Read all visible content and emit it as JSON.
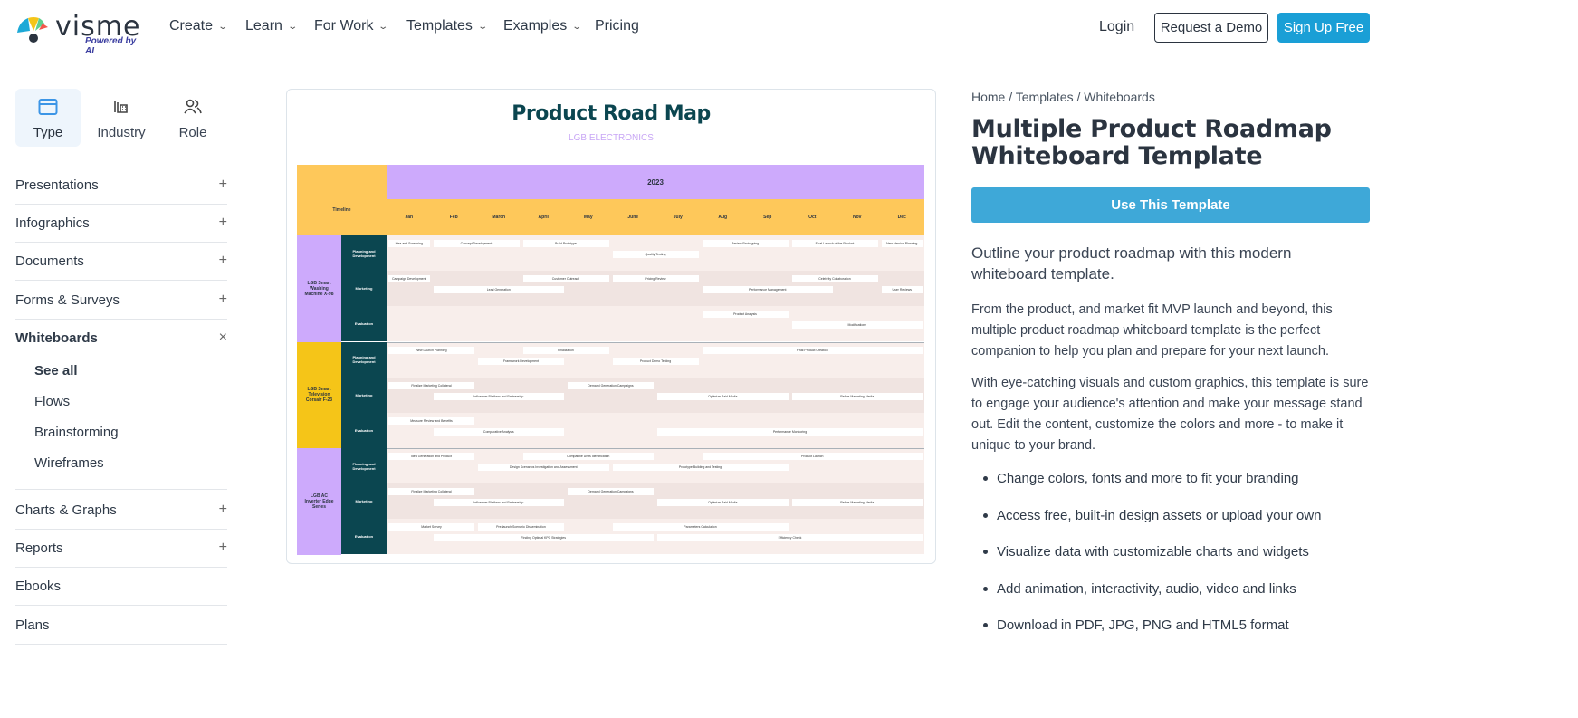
{
  "brand": {
    "name": "visme",
    "tagline": "Powered by AI"
  },
  "nav": {
    "items": [
      {
        "label": "Create",
        "dropdown": true
      },
      {
        "label": "Learn",
        "dropdown": true
      },
      {
        "label": "For Work",
        "dropdown": true
      },
      {
        "label": "Templates",
        "dropdown": true
      },
      {
        "label": "Examples",
        "dropdown": true
      },
      {
        "label": "Pricing",
        "dropdown": false
      }
    ],
    "login": "Login",
    "demo": "Request a Demo",
    "signup": "Sign Up Free"
  },
  "sidebar": {
    "tabs": [
      {
        "label": "Type",
        "icon": "window-icon",
        "active": true
      },
      {
        "label": "Industry",
        "icon": "building-icon"
      },
      {
        "label": "Role",
        "icon": "users-icon"
      }
    ],
    "categories": [
      {
        "label": "Presentations",
        "toggle": "+"
      },
      {
        "label": "Infographics",
        "toggle": "+"
      },
      {
        "label": "Documents",
        "toggle": "+"
      },
      {
        "label": "Forms & Surveys",
        "toggle": "+"
      },
      {
        "label": "Whiteboards",
        "toggle": "×",
        "expanded": true
      },
      {
        "label": "Charts & Graphs",
        "toggle": "+"
      },
      {
        "label": "Reports",
        "toggle": "+"
      },
      {
        "label": "Ebooks",
        "toggle": ""
      },
      {
        "label": "Plans",
        "toggle": ""
      }
    ],
    "sub_items": [
      "See all",
      "Flows",
      "Brainstorming",
      "Wireframes"
    ]
  },
  "preview": {
    "title": "Product Road Map",
    "subtitle": "LGB ELECTRONICS",
    "timeline_label": "Timeline",
    "year": "2023",
    "months": [
      "Jan",
      "Feb",
      "March",
      "April",
      "May",
      "June",
      "July",
      "Aug",
      "Sep",
      "Oct",
      "Nov",
      "Dec"
    ],
    "phases": [
      "Planning and Development",
      "Marketing",
      "Evaluation"
    ],
    "products": [
      {
        "name": "LGB Smart Washing Machine X-98",
        "color": "#cdaafc"
      },
      {
        "name": "LGB Smart Television Corsair F-23",
        "color": "#f5c518"
      },
      {
        "name": "LGB AC Inverter Edge Series",
        "color": "#cdaafc"
      }
    ],
    "colors": {
      "header_year": "#cdaafc",
      "header_months": "#fec85a",
      "phase": "#0b4650",
      "row_light": "#f8eeeb",
      "row_dark": "#f0e4e1"
    },
    "tasks": [
      {
        "p": 0,
        "r": 0,
        "s": 1,
        "e": 1,
        "l": 0,
        "t": "Idea and Screening"
      },
      {
        "p": 0,
        "r": 0,
        "s": 2,
        "e": 3,
        "l": 0,
        "t": "Concept Development"
      },
      {
        "p": 0,
        "r": 0,
        "s": 4,
        "e": 5,
        "l": 0,
        "t": "Build Prototype"
      },
      {
        "p": 0,
        "r": 0,
        "s": 6,
        "e": 7,
        "l": 1,
        "t": "Quality Testing"
      },
      {
        "p": 0,
        "r": 0,
        "s": 8,
        "e": 9,
        "l": 0,
        "t": "Review Prototyping"
      },
      {
        "p": 0,
        "r": 0,
        "s": 10,
        "e": 11,
        "l": 0,
        "t": "Final Launch of the Product"
      },
      {
        "p": 0,
        "r": 0,
        "s": 12,
        "e": 12,
        "l": 0,
        "t": "New Version Planning"
      },
      {
        "p": 0,
        "r": 1,
        "s": 1,
        "e": 1,
        "l": 0,
        "t": "Campaign Development"
      },
      {
        "p": 0,
        "r": 1,
        "s": 2,
        "e": 4,
        "l": 1,
        "t": "Lead Generation"
      },
      {
        "p": 0,
        "r": 1,
        "s": 4,
        "e": 5,
        "l": 0,
        "t": "Customer Outreach"
      },
      {
        "p": 0,
        "r": 1,
        "s": 6,
        "e": 7,
        "l": 0,
        "t": "Pricing Review"
      },
      {
        "p": 0,
        "r": 1,
        "s": 8,
        "e": 10,
        "l": 1,
        "t": "Performance Management"
      },
      {
        "p": 0,
        "r": 1,
        "s": 10,
        "e": 11,
        "l": 0,
        "t": "Celebrity Collaboration"
      },
      {
        "p": 0,
        "r": 1,
        "s": 12,
        "e": 12,
        "l": 1,
        "t": "User Reviews"
      },
      {
        "p": 0,
        "r": 2,
        "s": 8,
        "e": 9,
        "l": 0,
        "t": "Product Analysis"
      },
      {
        "p": 0,
        "r": 2,
        "s": 10,
        "e": 12,
        "l": 1,
        "t": "Modifications"
      },
      {
        "p": 1,
        "r": 0,
        "s": 1,
        "e": 2,
        "l": 0,
        "t": "New Launch Planning"
      },
      {
        "p": 1,
        "r": 0,
        "s": 3,
        "e": 4,
        "l": 1,
        "t": "Framework Development"
      },
      {
        "p": 1,
        "r": 0,
        "s": 4,
        "e": 5,
        "l": 0,
        "t": "Finalization"
      },
      {
        "p": 1,
        "r": 0,
        "s": 6,
        "e": 7,
        "l": 1,
        "t": "Product Demo Testing"
      },
      {
        "p": 1,
        "r": 0,
        "s": 8,
        "e": 12,
        "l": 0,
        "t": "Final Product Creation"
      },
      {
        "p": 1,
        "r": 1,
        "s": 1,
        "e": 2,
        "l": 0,
        "t": "Finalize Marketing Collateral"
      },
      {
        "p": 1,
        "r": 1,
        "s": 2,
        "e": 4,
        "l": 1,
        "t": "Influencer Platform and Partnership"
      },
      {
        "p": 1,
        "r": 1,
        "s": 5,
        "e": 6,
        "l": 0,
        "t": "Demand Generation Campaigns"
      },
      {
        "p": 1,
        "r": 1,
        "s": 7,
        "e": 9,
        "l": 1,
        "t": "Optimize Paid Media"
      },
      {
        "p": 1,
        "r": 1,
        "s": 10,
        "e": 12,
        "l": 1,
        "t": "Refine Marketing Media"
      },
      {
        "p": 1,
        "r": 2,
        "s": 1,
        "e": 2,
        "l": 0,
        "t": "Measure Review and Benefits"
      },
      {
        "p": 1,
        "r": 2,
        "s": 2,
        "e": 4,
        "l": 1,
        "t": "Comparative Analysis"
      },
      {
        "p": 1,
        "r": 2,
        "s": 7,
        "e": 12,
        "l": 1,
        "t": "Performance Monitoring"
      },
      {
        "p": 2,
        "r": 0,
        "s": 1,
        "e": 2,
        "l": 0,
        "t": "Idea Generation and Product"
      },
      {
        "p": 2,
        "r": 0,
        "s": 4,
        "e": 6,
        "l": 0,
        "t": "Compatible Units Identification"
      },
      {
        "p": 2,
        "r": 0,
        "s": 3,
        "e": 5,
        "l": 1,
        "t": "Design Scenarios Investigation and Assessment"
      },
      {
        "p": 2,
        "r": 0,
        "s": 6,
        "e": 9,
        "l": 1,
        "t": "Prototype Building and Testing"
      },
      {
        "p": 2,
        "r": 0,
        "s": 8,
        "e": 12,
        "l": 0,
        "t": "Product Launch"
      },
      {
        "p": 2,
        "r": 1,
        "s": 1,
        "e": 2,
        "l": 0,
        "t": "Finalize Marketing Collateral"
      },
      {
        "p": 2,
        "r": 1,
        "s": 2,
        "e": 4,
        "l": 1,
        "t": "Influencer Platform and Partnership"
      },
      {
        "p": 2,
        "r": 1,
        "s": 5,
        "e": 6,
        "l": 0,
        "t": "Demand Generation Campaigns"
      },
      {
        "p": 2,
        "r": 1,
        "s": 7,
        "e": 9,
        "l": 1,
        "t": "Optimize Paid Media"
      },
      {
        "p": 2,
        "r": 1,
        "s": 10,
        "e": 12,
        "l": 1,
        "t": "Refine Marketing Media"
      },
      {
        "p": 2,
        "r": 2,
        "s": 1,
        "e": 2,
        "l": 0,
        "t": "Market Survey"
      },
      {
        "p": 2,
        "r": 2,
        "s": 3,
        "e": 4,
        "l": 0,
        "t": "Pre-launch Scenario Dissemination"
      },
      {
        "p": 2,
        "r": 2,
        "s": 2,
        "e": 6,
        "l": 1,
        "t": "Finding Optimal KPC Strategies"
      },
      {
        "p": 2,
        "r": 2,
        "s": 6,
        "e": 9,
        "l": 0,
        "t": "Parameters Calculation"
      },
      {
        "p": 2,
        "r": 2,
        "s": 7,
        "e": 12,
        "l": 1,
        "t": "Efficiency Check"
      }
    ]
  },
  "detail": {
    "breadcrumb": "Home / Templates / Whiteboards",
    "title": "Multiple Product Roadmap Whiteboard Template",
    "cta": "Use This Template",
    "lead": "Outline your product roadmap with this modern whiteboard template.",
    "p1": "From the product, and market fit MVP launch and beyond, this multiple product roadmap whiteboard template is the perfect companion to help you plan and prepare for your next launch.",
    "p2": "With eye-catching visuals and custom graphics, this template is sure to engage your audience's attention and make your message stand out. Edit the content, customize the colors and more - to make it unique to your brand.",
    "bullets": [
      "Change colors, fonts and more to fit your branding",
      "Access free, built-in design assets or upload your own",
      "Visualize data with customizable charts and widgets",
      "Add animation, interactivity, audio, video and links",
      "Download in PDF, JPG, PNG and HTML5 format"
    ]
  },
  "colors": {
    "accent": "#1a9fd6",
    "cta": "#3ea8d8",
    "text": "#2b3440"
  }
}
